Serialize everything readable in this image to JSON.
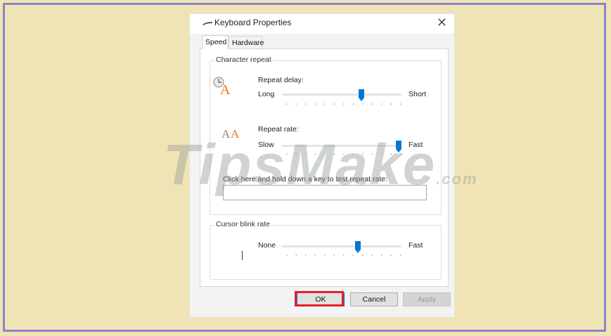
{
  "dialog": {
    "title": "Keyboard Properties",
    "close_glyph": "✕"
  },
  "tabs": [
    {
      "label": "Speed",
      "selected": true
    },
    {
      "label": "Hardware",
      "selected": false
    }
  ],
  "character_repeat": {
    "group_label": "Character repeat",
    "repeat_delay": {
      "label": "Repeat delay:",
      "min_label": "Long",
      "max_label": "Short",
      "level": 0.67
    },
    "repeat_rate": {
      "label": "Repeat rate:",
      "min_label": "Slow",
      "max_label": "Fast",
      "level": 1.0
    },
    "test_label": "Click here and hold down a key to test repeat rate:",
    "test_value": ""
  },
  "cursor_blink": {
    "group_label": "Cursor blink rate",
    "min_label": "None",
    "max_label": "Fast",
    "level": 0.64
  },
  "buttons": {
    "ok": "OK",
    "cancel": "Cancel",
    "apply": "Apply"
  },
  "watermark": {
    "text": "TipsMake",
    "suffix": ".com"
  },
  "colors": {
    "background": "#f0e4b6",
    "frame": "#8a84cc",
    "slider_thumb": "#0078d7",
    "highlight": "#e3202a"
  }
}
